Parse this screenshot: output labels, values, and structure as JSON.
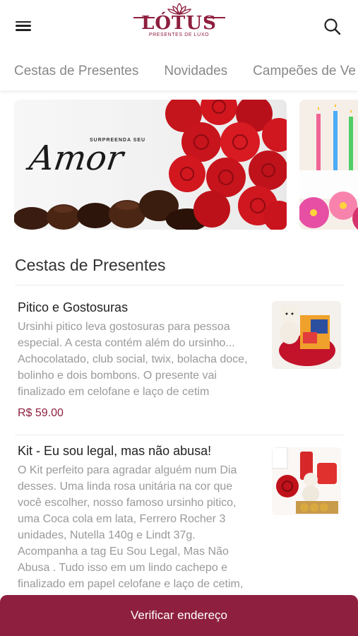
{
  "header": {
    "brand": "LÓTUS",
    "brand_tagline": "PRESENTES DE LUXO",
    "menu_icon": "hamburger-icon",
    "search_icon": "search-icon",
    "accent_color": "#8e1f3f"
  },
  "tabs": [
    {
      "label": "Cestas de Presentes"
    },
    {
      "label": "Novidades"
    },
    {
      "label": "Campeões de Ve"
    }
  ],
  "banners": [
    {
      "small_text": "SURPREENDA SEU",
      "big_text": "Amor"
    }
  ],
  "section": {
    "title": "Cestas de Presentes"
  },
  "products": [
    {
      "name": "Pitico e Gostosuras",
      "description": "Ursinhi pitico leva gostosuras para pessoa especial. A cesta contém além do ursinho... Achocolatado, club social, twix, bolacha doce, bolinho e dois bombons. O presente vai finalizado em celofane e laço de cetim",
      "price": "R$ 59.00"
    },
    {
      "name": "Kit - Eu sou legal, mas não abusa!",
      "description": "O Kit perfeito para agradar alguém num Dia desses. Uma linda rosa unitária na cor que você escolher, nosso famoso ursinho pitico, uma Coca cola em lata, Ferrero Rocher 3 unidades, Nutella 140g e Lindt 37g. Acompanha a tag Eu Sou Legal, Mas Não Abusa . Tudo isso em um lindo cachepo e finalizado em papel celofane e laço de cetim,",
      "price": ""
    }
  ],
  "bottom_bar": {
    "label": "Verificar endereço"
  }
}
